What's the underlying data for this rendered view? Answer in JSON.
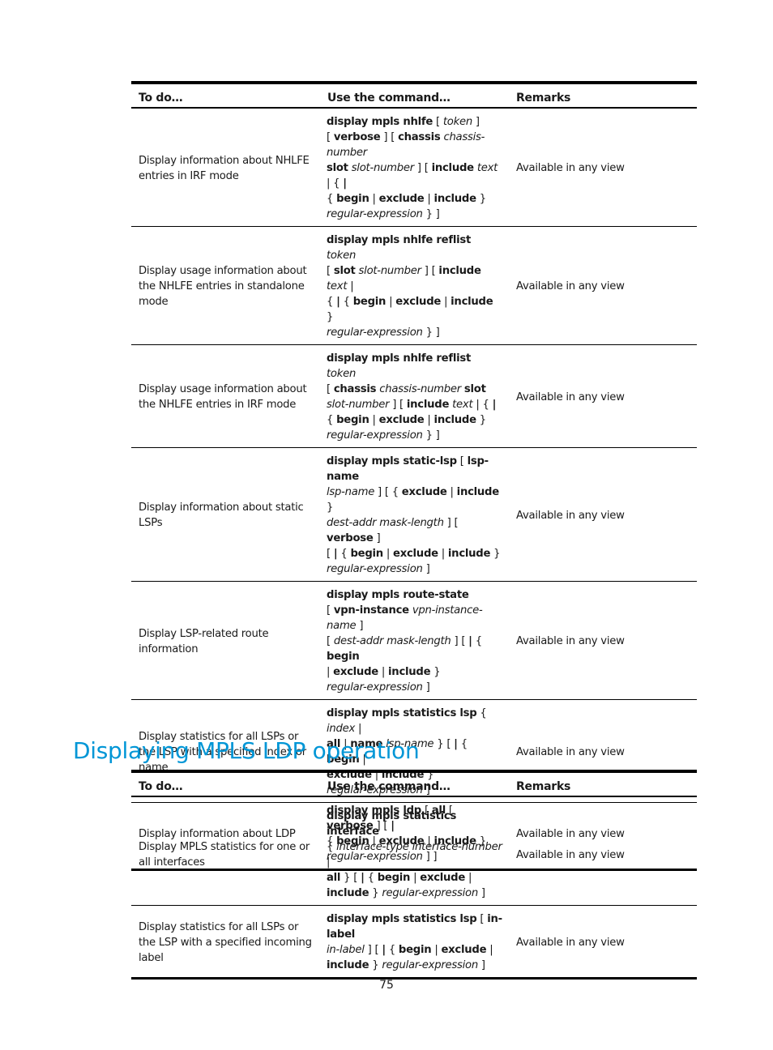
{
  "tables": [
    {
      "headers": [
        "To do…",
        "Use the command…",
        "Remarks"
      ],
      "rows": [
        {
          "todo": "Display information about NHLFE entries in IRF mode",
          "command": [
            [
              "b",
              "display mpls nhlfe"
            ],
            [
              "t",
              " [ "
            ],
            [
              "i",
              "token"
            ],
            [
              "t",
              " ]"
            ],
            [
              "br"
            ],
            [
              "t",
              "[ "
            ],
            [
              "b",
              "verbose"
            ],
            [
              "t",
              " ] [ "
            ],
            [
              "b",
              "chassis"
            ],
            [
              "t",
              " "
            ],
            [
              "i",
              "chassis-number"
            ],
            [
              "br"
            ],
            [
              "b",
              "slot"
            ],
            [
              "t",
              " "
            ],
            [
              "i",
              "slot-number"
            ],
            [
              "t",
              " ] [ "
            ],
            [
              "b",
              "include"
            ],
            [
              "t",
              " "
            ],
            [
              "i",
              "text"
            ],
            [
              "t",
              " | { "
            ],
            [
              "b",
              "|"
            ],
            [
              "br"
            ],
            [
              "t",
              "{ "
            ],
            [
              "b",
              "begin"
            ],
            [
              "t",
              " | "
            ],
            [
              "b",
              "exclude"
            ],
            [
              "t",
              " | "
            ],
            [
              "b",
              "include"
            ],
            [
              "t",
              " }"
            ],
            [
              "br"
            ],
            [
              "i",
              "regular-expression"
            ],
            [
              "t",
              " } ]"
            ]
          ],
          "remarks": "Available in any view"
        },
        {
          "todo": "Display usage information about the NHLFE entries in standalone mode",
          "command": [
            [
              "b",
              "display mpls nhlfe reflist"
            ],
            [
              "t",
              " "
            ],
            [
              "i",
              "token"
            ],
            [
              "br"
            ],
            [
              "t",
              "[ "
            ],
            [
              "b",
              "slot"
            ],
            [
              "t",
              " "
            ],
            [
              "i",
              "slot-number"
            ],
            [
              "t",
              " ] [ "
            ],
            [
              "b",
              "include"
            ],
            [
              "t",
              " "
            ],
            [
              "i",
              "text"
            ],
            [
              "t",
              " |"
            ],
            [
              "br"
            ],
            [
              "t",
              "{ "
            ],
            [
              "b",
              "|"
            ],
            [
              "t",
              " { "
            ],
            [
              "b",
              "begin"
            ],
            [
              "t",
              " | "
            ],
            [
              "b",
              "exclude"
            ],
            [
              "t",
              " | "
            ],
            [
              "b",
              "include"
            ],
            [
              "t",
              " }"
            ],
            [
              "br"
            ],
            [
              "i",
              "regular-expression"
            ],
            [
              "t",
              " } ]"
            ]
          ],
          "remarks": "Available in any view"
        },
        {
          "todo": "Display usage information about the NHLFE entries in IRF mode",
          "command": [
            [
              "b",
              "display mpls nhlfe reflist"
            ],
            [
              "t",
              " "
            ],
            [
              "i",
              "token"
            ],
            [
              "br"
            ],
            [
              "t",
              "[ "
            ],
            [
              "b",
              "chassis"
            ],
            [
              "t",
              " "
            ],
            [
              "i",
              "chassis-number"
            ],
            [
              "t",
              " "
            ],
            [
              "b",
              "slot"
            ],
            [
              "br"
            ],
            [
              "i",
              "slot-number"
            ],
            [
              "t",
              " ] [ "
            ],
            [
              "b",
              "include"
            ],
            [
              "t",
              " "
            ],
            [
              "i",
              "text"
            ],
            [
              "t",
              " | { "
            ],
            [
              "b",
              "|"
            ],
            [
              "br"
            ],
            [
              "t",
              "{ "
            ],
            [
              "b",
              "begin"
            ],
            [
              "t",
              " | "
            ],
            [
              "b",
              "exclude"
            ],
            [
              "t",
              " | "
            ],
            [
              "b",
              "include"
            ],
            [
              "t",
              " }"
            ],
            [
              "br"
            ],
            [
              "i",
              "regular-expression"
            ],
            [
              "t",
              " } ]"
            ]
          ],
          "remarks": "Available in any view"
        },
        {
          "todo": "Display information about static LSPs",
          "command": [
            [
              "b",
              "display mpls static-lsp"
            ],
            [
              "t",
              " [ "
            ],
            [
              "b",
              "lsp-name"
            ],
            [
              "br"
            ],
            [
              "i",
              "lsp-name"
            ],
            [
              "t",
              " ] [ { "
            ],
            [
              "b",
              "exclude"
            ],
            [
              "t",
              " | "
            ],
            [
              "b",
              "include"
            ],
            [
              "t",
              " }"
            ],
            [
              "br"
            ],
            [
              "i",
              "dest-addr mask-length"
            ],
            [
              "t",
              " ] [ "
            ],
            [
              "b",
              "verbose"
            ],
            [
              "t",
              " ]"
            ],
            [
              "br"
            ],
            [
              "t",
              "[ "
            ],
            [
              "b",
              "|"
            ],
            [
              "t",
              " { "
            ],
            [
              "b",
              "begin"
            ],
            [
              "t",
              " | "
            ],
            [
              "b",
              "exclude"
            ],
            [
              "t",
              " | "
            ],
            [
              "b",
              "include"
            ],
            [
              "t",
              " }"
            ],
            [
              "br"
            ],
            [
              "i",
              "regular-expression"
            ],
            [
              "t",
              " ]"
            ]
          ],
          "remarks": "Available in any view"
        },
        {
          "todo": "Display LSP-related route information",
          "command": [
            [
              "b",
              "display mpls route-state"
            ],
            [
              "br"
            ],
            [
              "t",
              "[ "
            ],
            [
              "b",
              "vpn-instance"
            ],
            [
              "t",
              " "
            ],
            [
              "i",
              "vpn-instance-name"
            ],
            [
              "t",
              " ]"
            ],
            [
              "br"
            ],
            [
              "t",
              "[ "
            ],
            [
              "i",
              "dest-addr mask-length"
            ],
            [
              "t",
              " ] [ "
            ],
            [
              "b",
              "|"
            ],
            [
              "t",
              " { "
            ],
            [
              "b",
              "begin"
            ],
            [
              "br"
            ],
            [
              "t",
              "| "
            ],
            [
              "b",
              "exclude"
            ],
            [
              "t",
              " | "
            ],
            [
              "b",
              "include"
            ],
            [
              "t",
              " }"
            ],
            [
              "br"
            ],
            [
              "i",
              "regular-expression"
            ],
            [
              "t",
              " ]"
            ]
          ],
          "remarks": "Available in any view"
        },
        {
          "todo": "Display statistics for all LSPs or the LSP with a specified index or name",
          "command": [
            [
              "b",
              "display mpls statistics lsp"
            ],
            [
              "t",
              " { "
            ],
            [
              "i",
              "index"
            ],
            [
              "t",
              " |"
            ],
            [
              "br"
            ],
            [
              "b",
              "all"
            ],
            [
              "t",
              " | "
            ],
            [
              "b",
              "name"
            ],
            [
              "t",
              " "
            ],
            [
              "i",
              "lsp-name"
            ],
            [
              "t",
              " } [ "
            ],
            [
              "b",
              "|"
            ],
            [
              "t",
              " { "
            ],
            [
              "b",
              "begin"
            ],
            [
              "t",
              " |"
            ],
            [
              "br"
            ],
            [
              "b",
              "exclude"
            ],
            [
              "t",
              " | "
            ],
            [
              "b",
              "include"
            ],
            [
              "t",
              " }"
            ],
            [
              "br"
            ],
            [
              "i",
              "regular-expression"
            ],
            [
              "t",
              " ]"
            ]
          ],
          "remarks": "Available in any view"
        },
        {
          "todo": "Display MPLS statistics for one or all interfaces",
          "command": [
            [
              "b",
              "display mpls statistics interface"
            ],
            [
              "br"
            ],
            [
              "t",
              "{ "
            ],
            [
              "i",
              "interface-type interface-number"
            ],
            [
              "t",
              " |"
            ],
            [
              "br"
            ],
            [
              "b",
              "all"
            ],
            [
              "t",
              " } [ "
            ],
            [
              "b",
              "|"
            ],
            [
              "t",
              " { "
            ],
            [
              "b",
              "begin"
            ],
            [
              "t",
              " | "
            ],
            [
              "b",
              "exclude"
            ],
            [
              "t",
              " |"
            ],
            [
              "br"
            ],
            [
              "b",
              "include"
            ],
            [
              "t",
              " } "
            ],
            [
              "i",
              "regular-expression"
            ],
            [
              "t",
              " ]"
            ]
          ],
          "remarks": "Available in any view"
        },
        {
          "todo": "Display statistics for all LSPs or the LSP with a specified incoming label",
          "command": [
            [
              "b",
              "display mpls statistics lsp"
            ],
            [
              "t",
              " [ "
            ],
            [
              "b",
              "in-label"
            ],
            [
              "br"
            ],
            [
              "i",
              "in-label"
            ],
            [
              "t",
              " ] [ "
            ],
            [
              "b",
              "|"
            ],
            [
              "t",
              " { "
            ],
            [
              "b",
              "begin"
            ],
            [
              "t",
              " | "
            ],
            [
              "b",
              "exclude"
            ],
            [
              "t",
              " |"
            ],
            [
              "br"
            ],
            [
              "b",
              "include"
            ],
            [
              "t",
              " } "
            ],
            [
              "i",
              "regular-expression"
            ],
            [
              "t",
              " ]"
            ]
          ],
          "remarks": "Available in any view"
        }
      ]
    },
    {
      "headers": [
        "To do…",
        "Use the command…",
        "Remarks"
      ],
      "rows": [
        {
          "todo": "Display information about LDP",
          "command": [
            [
              "b",
              "display mpls ldp"
            ],
            [
              "t",
              " [ "
            ],
            [
              "b",
              "all"
            ],
            [
              "t",
              " [ "
            ],
            [
              "b",
              "verbose"
            ],
            [
              "t",
              " ] [ "
            ],
            [
              "b",
              "|"
            ],
            [
              "br"
            ],
            [
              "t",
              "{ "
            ],
            [
              "b",
              "begin"
            ],
            [
              "t",
              " | "
            ],
            [
              "b",
              "exclude"
            ],
            [
              "t",
              " | "
            ],
            [
              "b",
              "include"
            ],
            [
              "t",
              " }"
            ],
            [
              "br"
            ],
            [
              "i",
              "regular-expression"
            ],
            [
              "t",
              " ] ]"
            ]
          ],
          "remarks": "Available in any view"
        }
      ]
    }
  ],
  "section_heading": "Displaying MPLS LDP operation",
  "colors": {
    "heading": "#0096d6",
    "rule": "#000000"
  },
  "page_number": "75"
}
